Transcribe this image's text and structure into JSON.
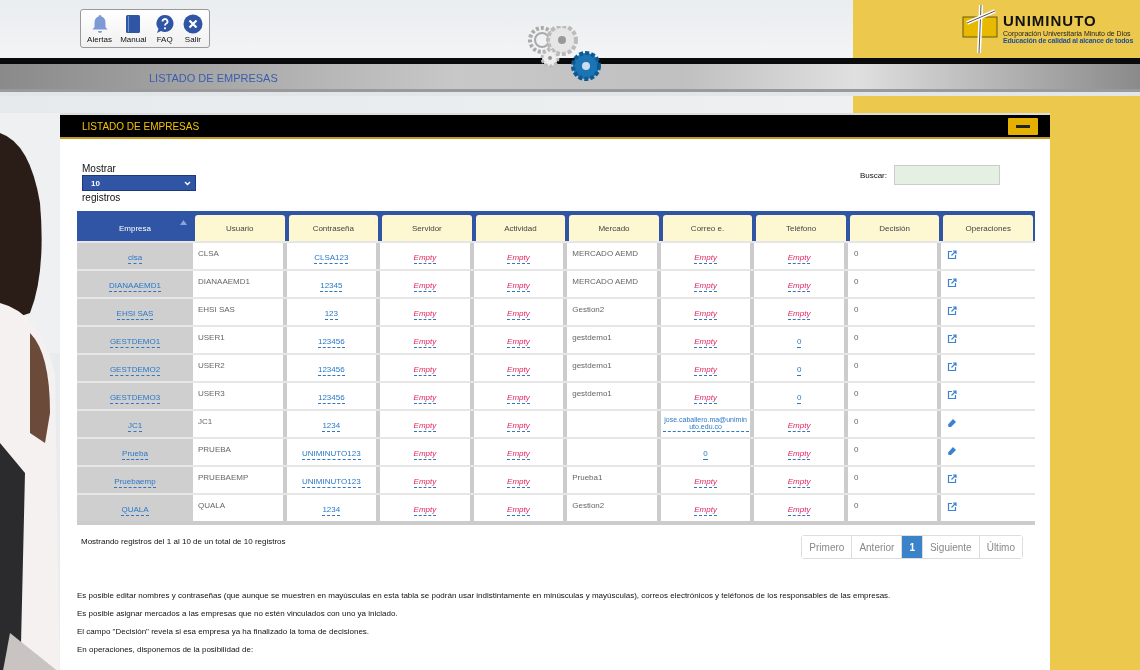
{
  "toolbar": [
    {
      "label": "Alertas",
      "kind": "bell"
    },
    {
      "label": "Manual",
      "kind": "book"
    },
    {
      "label": "FAQ",
      "kind": "help"
    },
    {
      "label": "Salir",
      "kind": "close"
    }
  ],
  "logo": {
    "name": "UNIMINUTO",
    "subtitle": "Corporación Universitaria Minuto de Dios",
    "tagline": "Educación de calidad al alcance de todos"
  },
  "page_title": "LISTADO DE EMPRESAS",
  "panel": {
    "title": "LISTADO DE EMPRESAS",
    "length": {
      "label_before": "Mostrar",
      "value": "10",
      "label_after": "registros"
    },
    "search": {
      "label": "Buscar:"
    },
    "columns": [
      {
        "label": "Empresa",
        "selected": true
      },
      {
        "label": "Usuario",
        "selected": false
      },
      {
        "label": "Contraseña",
        "selected": false
      },
      {
        "label": "Servidor",
        "selected": false
      },
      {
        "label": "Actividad",
        "selected": false
      },
      {
        "label": "Mercado",
        "selected": false
      },
      {
        "label": "Correo e.",
        "selected": false
      },
      {
        "label": "Teléfono",
        "selected": false
      },
      {
        "label": "Decisión",
        "selected": false
      },
      {
        "label": "Operaciones",
        "selected": false
      }
    ],
    "rows": [
      {
        "cells": [
          {
            "kind": "link",
            "text": "clsa"
          },
          {
            "kind": "plain",
            "text": "CLSA"
          },
          {
            "kind": "link",
            "text": "CLSA123"
          },
          {
            "kind": "empty",
            "text": "Empty"
          },
          {
            "kind": "empty",
            "text": "Empty"
          },
          {
            "kind": "plain",
            "text": "MERCADO AEMD"
          },
          {
            "kind": "empty",
            "text": "Empty"
          },
          {
            "kind": "empty",
            "text": "Empty"
          },
          {
            "kind": "plain",
            "text": "0"
          },
          {
            "kind": "edit"
          }
        ]
      },
      {
        "cells": [
          {
            "kind": "link",
            "text": "DIANAAEMD1"
          },
          {
            "kind": "plain",
            "text": "DIANAAEMD1"
          },
          {
            "kind": "link",
            "text": "12345"
          },
          {
            "kind": "empty",
            "text": "Empty"
          },
          {
            "kind": "empty",
            "text": "Empty"
          },
          {
            "kind": "plain",
            "text": "MERCADO AEMD"
          },
          {
            "kind": "empty",
            "text": "Empty"
          },
          {
            "kind": "empty",
            "text": "Empty"
          },
          {
            "kind": "plain",
            "text": "0"
          },
          {
            "kind": "edit"
          }
        ]
      },
      {
        "cells": [
          {
            "kind": "link",
            "text": "EHSI SAS"
          },
          {
            "kind": "plain",
            "text": "EHSI SAS"
          },
          {
            "kind": "link",
            "text": "123"
          },
          {
            "kind": "empty",
            "text": "Empty"
          },
          {
            "kind": "empty",
            "text": "Empty"
          },
          {
            "kind": "plain",
            "text": "Gestion2"
          },
          {
            "kind": "empty",
            "text": "Empty"
          },
          {
            "kind": "empty",
            "text": "Empty"
          },
          {
            "kind": "plain",
            "text": "0"
          },
          {
            "kind": "edit"
          }
        ]
      },
      {
        "cells": [
          {
            "kind": "link",
            "text": "GESTDEMO1"
          },
          {
            "kind": "plain",
            "text": "USER1"
          },
          {
            "kind": "link",
            "text": "123456"
          },
          {
            "kind": "empty",
            "text": "Empty"
          },
          {
            "kind": "empty",
            "text": "Empty"
          },
          {
            "kind": "plain",
            "text": "gestdemo1"
          },
          {
            "kind": "empty",
            "text": "Empty"
          },
          {
            "kind": "link",
            "text": "0"
          },
          {
            "kind": "plain",
            "text": "0"
          },
          {
            "kind": "edit"
          }
        ]
      },
      {
        "cells": [
          {
            "kind": "link",
            "text": "GESTDEMO2"
          },
          {
            "kind": "plain",
            "text": "USER2"
          },
          {
            "kind": "link",
            "text": "123456"
          },
          {
            "kind": "empty",
            "text": "Empty"
          },
          {
            "kind": "empty",
            "text": "Empty"
          },
          {
            "kind": "plain",
            "text": "gestdemo1"
          },
          {
            "kind": "empty",
            "text": "Empty"
          },
          {
            "kind": "link",
            "text": "0"
          },
          {
            "kind": "plain",
            "text": "0"
          },
          {
            "kind": "edit"
          }
        ]
      },
      {
        "cells": [
          {
            "kind": "link",
            "text": "GESTDEMO3"
          },
          {
            "kind": "plain",
            "text": "USER3"
          },
          {
            "kind": "link",
            "text": "123456"
          },
          {
            "kind": "empty",
            "text": "Empty"
          },
          {
            "kind": "empty",
            "text": "Empty"
          },
          {
            "kind": "plain",
            "text": "gestdemo1"
          },
          {
            "kind": "empty",
            "text": "Empty"
          },
          {
            "kind": "link",
            "text": "0"
          },
          {
            "kind": "plain",
            "text": "0"
          },
          {
            "kind": "edit"
          }
        ]
      },
      {
        "cells": [
          {
            "kind": "link",
            "text": "JC1"
          },
          {
            "kind": "plain",
            "text": "JC1"
          },
          {
            "kind": "link",
            "text": "1234"
          },
          {
            "kind": "empty",
            "text": "Empty"
          },
          {
            "kind": "empty",
            "text": "Empty"
          },
          {
            "kind": "blank"
          },
          {
            "kind": "link",
            "text": "jose.caballero.ma@uniminuto.edu.co"
          },
          {
            "kind": "empty",
            "text": "Empty"
          },
          {
            "kind": "plain",
            "text": "0"
          },
          {
            "kind": "erase"
          }
        ]
      },
      {
        "cells": [
          {
            "kind": "link",
            "text": "Prueba"
          },
          {
            "kind": "plain",
            "text": "PRUEBA"
          },
          {
            "kind": "link",
            "text": "UNIMINUTO123"
          },
          {
            "kind": "empty",
            "text": "Empty"
          },
          {
            "kind": "empty",
            "text": "Empty"
          },
          {
            "kind": "blank"
          },
          {
            "kind": "link",
            "text": "0"
          },
          {
            "kind": "empty",
            "text": "Empty"
          },
          {
            "kind": "plain",
            "text": "0"
          },
          {
            "kind": "erase"
          }
        ]
      },
      {
        "cells": [
          {
            "kind": "link",
            "text": "Pruebaemp"
          },
          {
            "kind": "plain",
            "text": "PRUEBAEMP"
          },
          {
            "kind": "link",
            "text": "UNIMINUTO123"
          },
          {
            "kind": "empty",
            "text": "Empty"
          },
          {
            "kind": "empty",
            "text": "Empty"
          },
          {
            "kind": "plain",
            "text": "Prueba1"
          },
          {
            "kind": "empty",
            "text": "Empty"
          },
          {
            "kind": "empty",
            "text": "Empty"
          },
          {
            "kind": "plain",
            "text": "0"
          },
          {
            "kind": "edit"
          }
        ]
      },
      {
        "cells": [
          {
            "kind": "link",
            "text": "QUALA"
          },
          {
            "kind": "plain",
            "text": "QUALA"
          },
          {
            "kind": "link",
            "text": "1234"
          },
          {
            "kind": "empty",
            "text": "Empty"
          },
          {
            "kind": "empty",
            "text": "Empty"
          },
          {
            "kind": "plain",
            "text": "Gestion2"
          },
          {
            "kind": "empty",
            "text": "Empty"
          },
          {
            "kind": "empty",
            "text": "Empty"
          },
          {
            "kind": "plain",
            "text": "0"
          },
          {
            "kind": "edit"
          }
        ]
      }
    ],
    "info": "Mostrando registros del 1 al 10 de un total de 10 registros",
    "pagination": [
      {
        "label": "Primero",
        "selected": false
      },
      {
        "label": "Anterior",
        "selected": false
      },
      {
        "label": "1",
        "selected": true
      },
      {
        "label": "Siguiente",
        "selected": false
      },
      {
        "label": "Último",
        "selected": false
      }
    ],
    "notes": [
      "Es posible editar nombres y contraseñas (que aunque se muestren en mayúsculas en esta tabla se podrán usar indistintamente en minúsculas y mayúsculas), correos electrónicos y teléfonos de los responsables de las empresas.",
      "Es posible asignar mercados a las empresas que no estén vinculados con uno ya iniciado.",
      "El campo \"Decisión\" revela si esa empresa ya ha finalizado la toma de decisiones.",
      "En operaciones, disponemos de la posibilidad de:"
    ]
  }
}
